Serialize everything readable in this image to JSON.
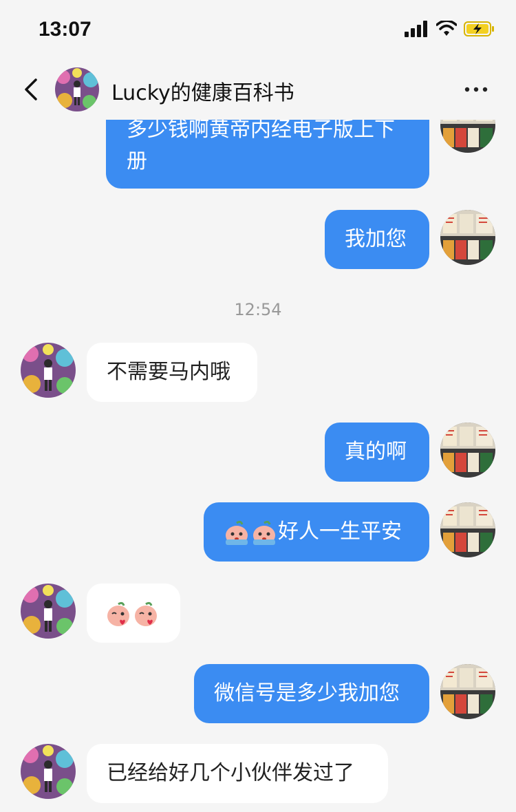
{
  "status": {
    "time": "13:07"
  },
  "header": {
    "title": "Lucky的健康百科书"
  },
  "timestamp": "12:54",
  "messages": {
    "m1": "多少钱啊黄帝内经电子版上下册",
    "m2": "我加您",
    "m3": "不需要马内哦",
    "m4": "真的啊",
    "m5": "好人一生平安",
    "m7": "微信号是多少我加您",
    "m8": "已经给好几个小伙伴发过了"
  },
  "colors": {
    "accent": "#3b8cf2",
    "background": "#f5f5f5"
  }
}
